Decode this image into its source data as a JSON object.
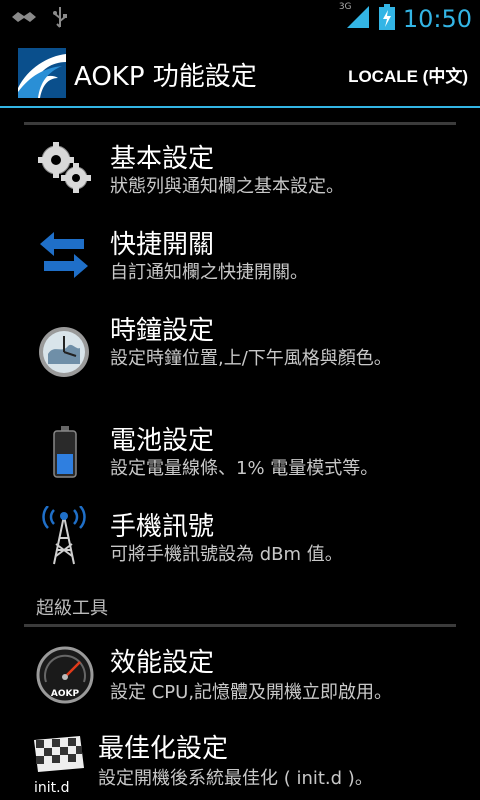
{
  "status": {
    "network": "3G",
    "time": "10:50"
  },
  "header": {
    "title": "AOKP 功能設定",
    "locale_button": "LOCALE (中文)"
  },
  "items": [
    {
      "title": "基本設定",
      "summary": "狀態列與通知欄之基本設定。",
      "icon": "gears-icon"
    },
    {
      "title": "快捷開關",
      "summary": "自訂通知欄之快捷開關。",
      "icon": "toggle-arrows-icon"
    },
    {
      "title": "時鐘設定",
      "summary": "設定時鐘位置,上/下午風格與顏色。",
      "icon": "clock-icon"
    },
    {
      "title": "電池設定",
      "summary": "設定電量線條、1% 電量模式等。",
      "icon": "battery-icon"
    },
    {
      "title": "手機訊號",
      "summary": "可將手機訊號設為 dBm 值。",
      "icon": "signal-tower-icon"
    }
  ],
  "section": {
    "label": "超級工具"
  },
  "tools": [
    {
      "title": "效能設定",
      "summary": "設定 CPU,記憶體及開機立即啟用。",
      "icon": "speedometer-icon",
      "badge": "AOKP"
    },
    {
      "title": "最佳化設定",
      "summary": "設定開機後系統最佳化 ( init.d )。",
      "icon": "checkered-flag-icon",
      "badge": "init.d"
    }
  ]
}
